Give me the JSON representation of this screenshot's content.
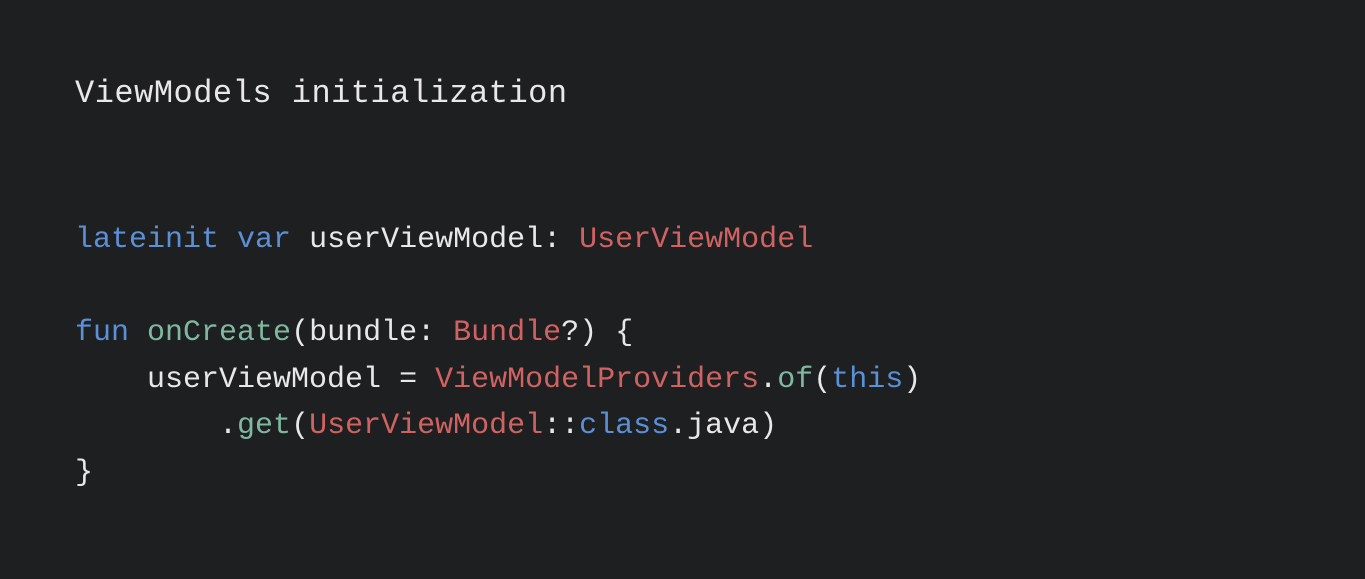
{
  "title": "ViewModels initialization",
  "code": {
    "kw_lateinit": "lateinit",
    "kw_var": "var",
    "ident_userViewModel": "userViewModel",
    "colon1": ":",
    "type_UserViewModel": "UserViewModel",
    "kw_fun": "fun",
    "fn_onCreate": "onCreate",
    "lparen1": "(",
    "ident_bundle": "bundle",
    "colon2": ":",
    "type_Bundle": "Bundle",
    "qmark": "?",
    "rparen1": ")",
    "lbrace": "{",
    "ident_userViewModel2": "userViewModel",
    "eq": "=",
    "type_ViewModelProviders": "ViewModelProviders",
    "dot1": ".",
    "fn_of": "of",
    "lparen2": "(",
    "kw_this": "this",
    "rparen2": ")",
    "dot2": ".",
    "fn_get": "get",
    "lparen3": "(",
    "type_UserViewModel2": "UserViewModel",
    "dcolon": "::",
    "kw_class": "class",
    "dot3": ".",
    "ident_java": "java",
    "rparen3": ")",
    "rbrace": "}"
  }
}
